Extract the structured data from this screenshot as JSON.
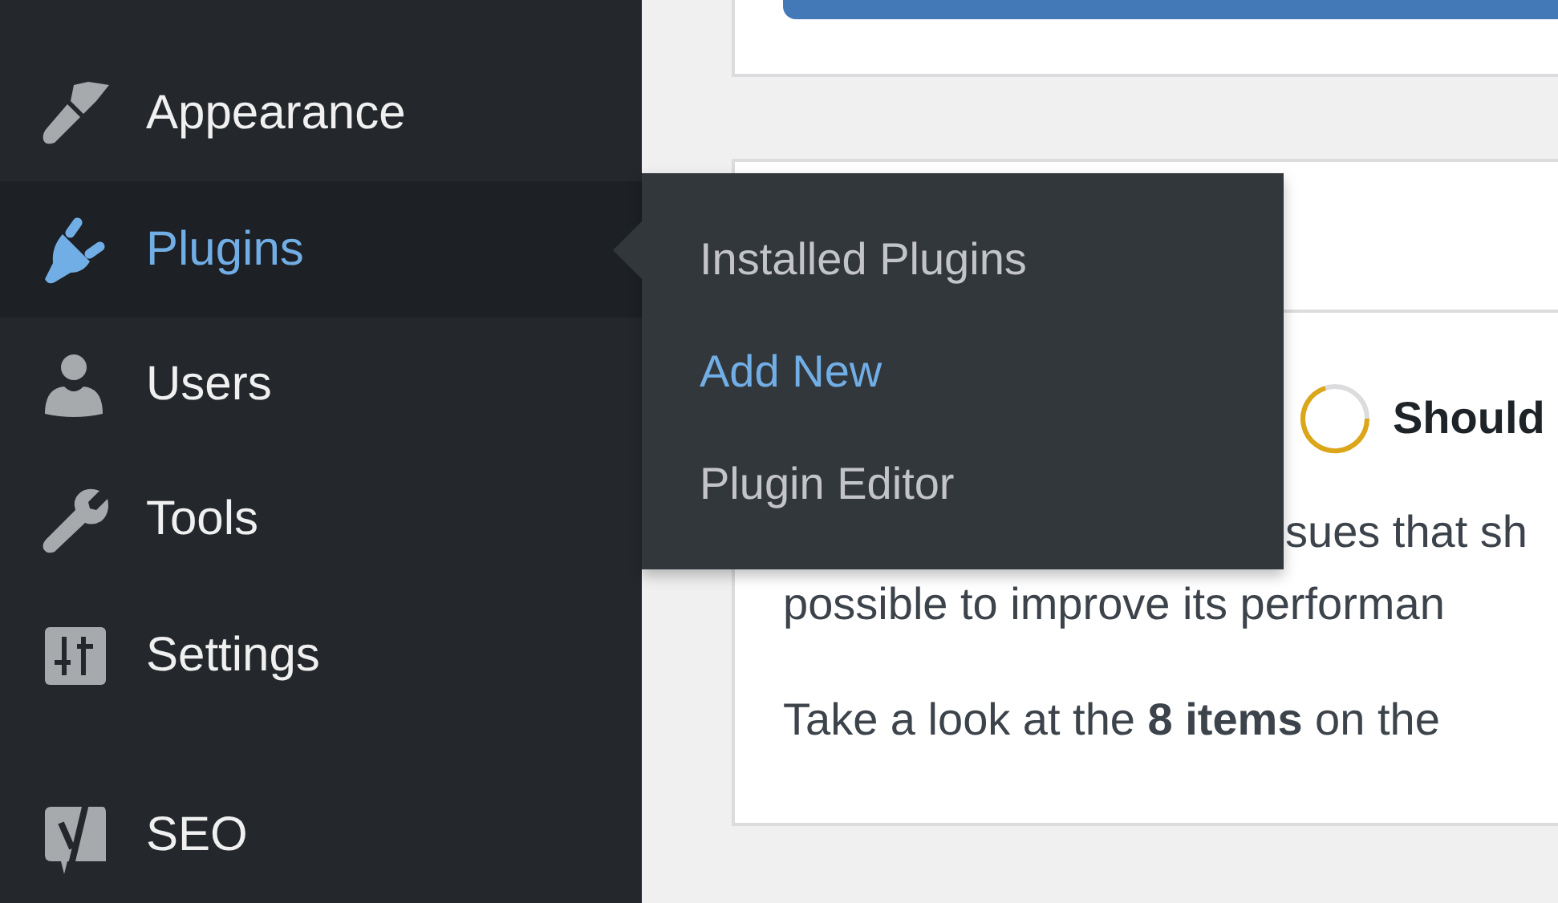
{
  "sidebar": {
    "items": [
      {
        "label": "Appearance",
        "kind": "brush",
        "selected": false,
        "separator_before": false
      },
      {
        "label": "Plugins",
        "kind": "plug",
        "selected": true,
        "separator_before": false
      },
      {
        "label": "Users",
        "kind": "user",
        "selected": false,
        "separator_before": false
      },
      {
        "label": "Tools",
        "kind": "wrench",
        "selected": false,
        "separator_before": false
      },
      {
        "label": "Settings",
        "kind": "sliders",
        "selected": false,
        "separator_before": false
      },
      {
        "label": "SEO",
        "kind": "yoast",
        "selected": false,
        "separator_before": true
      }
    ]
  },
  "flyout": {
    "items": [
      {
        "label": "Installed Plugins",
        "selected": false
      },
      {
        "label": "Add New",
        "selected": true
      },
      {
        "label": "Plugin Editor",
        "selected": false
      }
    ]
  },
  "health_card": {
    "status": "Should",
    "lines": [
      "sues that sh",
      "possible to improve its performan"
    ],
    "summary": "Take a look at the **8 items** on the"
  }
}
